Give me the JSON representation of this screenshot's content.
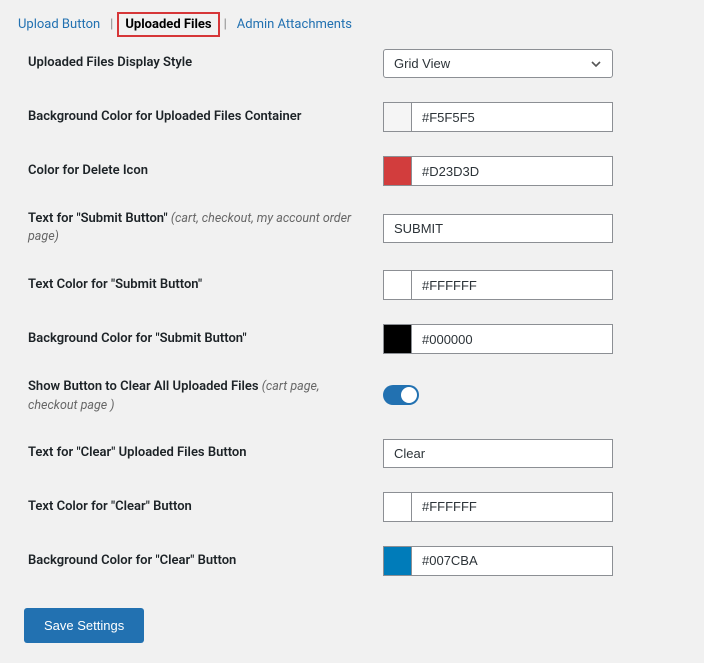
{
  "tabs": {
    "upload_button": "Upload Button",
    "uploaded_files": "Uploaded Files",
    "admin_attachments": "Admin Attachments"
  },
  "fields": {
    "display_style": {
      "label": "Uploaded Files Display Style",
      "value": "Grid View"
    },
    "bg_container": {
      "label": "Background Color for Uploaded Files Container",
      "value": "#F5F5F5",
      "swatch": "#F5F5F5"
    },
    "delete_icon": {
      "label": "Color for Delete Icon",
      "value": "#D23D3D",
      "swatch": "#D23D3D"
    },
    "submit_text": {
      "label": "Text for \"Submit Button\"",
      "sub": "(cart, checkout, my account order page)",
      "value": "SUBMIT"
    },
    "submit_text_color": {
      "label": "Text Color for \"Submit Button\"",
      "value": "#FFFFFF",
      "swatch": "#FFFFFF"
    },
    "submit_bg_color": {
      "label": "Background Color for \"Submit Button\"",
      "value": "#000000",
      "swatch": "#000000"
    },
    "show_clear_btn": {
      "label": "Show Button to Clear All Uploaded Files",
      "sub": "(cart page, checkout page )"
    },
    "clear_text": {
      "label": "Text for \"Clear\" Uploaded Files Button",
      "value": "Clear"
    },
    "clear_text_color": {
      "label": "Text Color for \"Clear\" Button",
      "value": "#FFFFFF",
      "swatch": "#FFFFFF"
    },
    "clear_bg_color": {
      "label": "Background Color for \"Clear\" Button",
      "value": "#007CBA",
      "swatch": "#007CBA"
    }
  },
  "buttons": {
    "save": "Save Settings"
  }
}
